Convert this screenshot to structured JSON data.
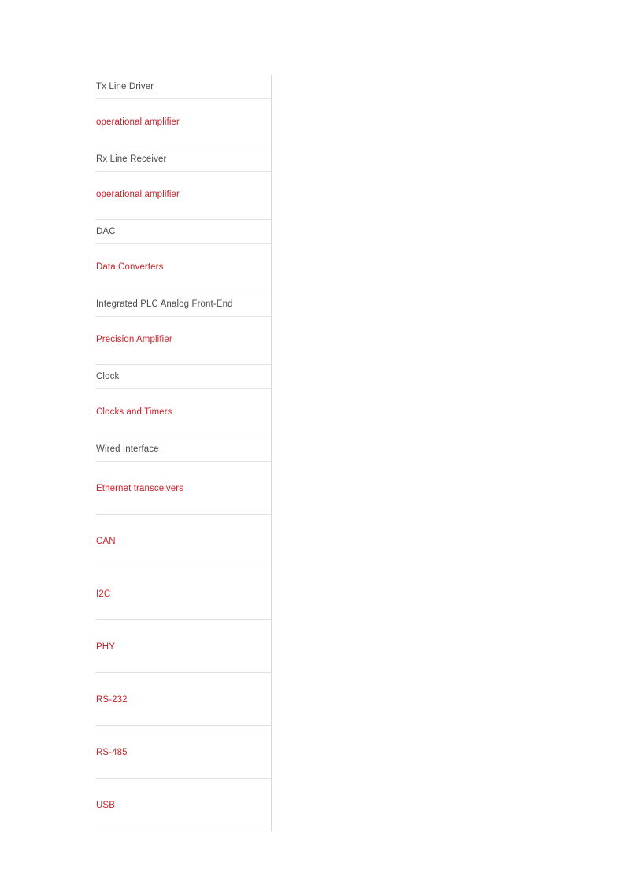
{
  "colors": {
    "heading_text": "#4a4a4a",
    "link_text": "#cc2229",
    "border": "#e0e0e0",
    "right_border": "#d8d8d8",
    "background": "#ffffff"
  },
  "table": {
    "name": "product-category-table",
    "rows": [
      {
        "type": "heading",
        "label": "Tx Line Driver"
      },
      {
        "type": "link",
        "label": "operational amplifier"
      },
      {
        "type": "heading",
        "label": "Rx Line Receiver"
      },
      {
        "type": "link",
        "label": "operational amplifier"
      },
      {
        "type": "heading",
        "label": "DAC"
      },
      {
        "type": "link",
        "label": "Data Converters"
      },
      {
        "type": "heading",
        "label": "Integrated PLC Analog Front-End"
      },
      {
        "type": "link",
        "label": "Precision Amplifier"
      },
      {
        "type": "heading",
        "label": "Clock"
      },
      {
        "type": "link",
        "label": "Clocks and Timers"
      },
      {
        "type": "heading",
        "label": "Wired Interface"
      },
      {
        "type": "link",
        "label": "Ethernet transceivers"
      },
      {
        "type": "link",
        "label": "CAN"
      },
      {
        "type": "link",
        "label": "I2C"
      },
      {
        "type": "link",
        "label": "PHY"
      },
      {
        "type": "link",
        "label": "RS-232"
      },
      {
        "type": "link",
        "label": "RS-485"
      },
      {
        "type": "link",
        "label": "USB"
      }
    ]
  }
}
